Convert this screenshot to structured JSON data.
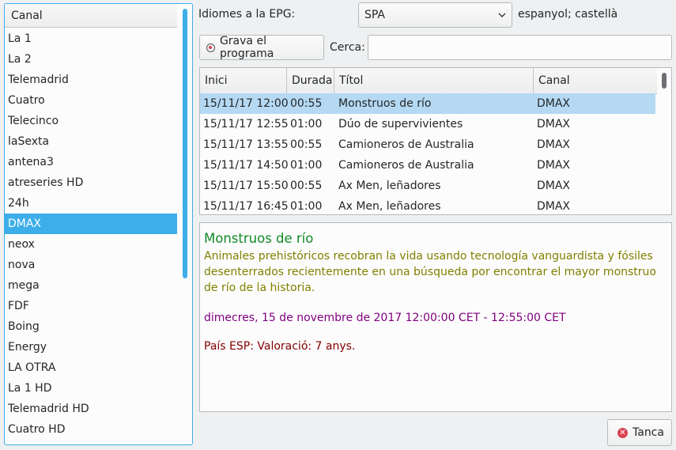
{
  "channels": {
    "header": "Canal",
    "items": [
      "La 1",
      "La 2",
      "Telemadrid",
      "Cuatro",
      "Telecinco",
      "laSexta",
      "antena3",
      "atreseries HD",
      "24h",
      "DMAX",
      "neox",
      "nova",
      "mega",
      "FDF",
      "Boing",
      "Energy",
      "LA OTRA",
      "La 1 HD",
      "Telemadrid HD",
      "Cuatro HD"
    ],
    "selected": "DMAX"
  },
  "epg_language": {
    "label": "Idiomes a la EPG:",
    "selected": "SPA",
    "description": "espanyol; castellà"
  },
  "record_button": {
    "label": "Grava el programa",
    "icon": "record-icon"
  },
  "search": {
    "label": "Cerca:",
    "value": ""
  },
  "program_table": {
    "columns": [
      "Inici",
      "Durada",
      "Títol",
      "Canal"
    ],
    "rows": [
      {
        "start": "15/11/17 12:00",
        "duration": "00:55",
        "title": "Monstruos de río",
        "channel": "DMAX"
      },
      {
        "start": "15/11/17 12:55",
        "duration": "01:00",
        "title": "Dúo de supervivientes",
        "channel": "DMAX"
      },
      {
        "start": "15/11/17 13:55",
        "duration": "00:55",
        "title": "Camioneros de Australia",
        "channel": "DMAX"
      },
      {
        "start": "15/11/17 14:50",
        "duration": "01:00",
        "title": "Camioneros de Australia",
        "channel": "DMAX"
      },
      {
        "start": "15/11/17 15:50",
        "duration": "00:55",
        "title": "Ax Men, leñadores",
        "channel": "DMAX"
      },
      {
        "start": "15/11/17 16:45",
        "duration": "01:00",
        "title": "Ax Men, leñadores",
        "channel": "DMAX"
      }
    ],
    "selected_row": 0
  },
  "details": {
    "title": "Monstruos de río",
    "description": "Animales prehistóricos recobran la vida usando tecnología vanguardista y fósiles desenterrados recientemente en una búsqueda por encontrar el mayor monstruo de río de la historia.",
    "date": "dimecres, 15 de novembre de 2017 12:00:00 CET - 12:55:00 CET",
    "rating": "País ESP: Valoració: 7 anys."
  },
  "close_button": {
    "label": "Tanca",
    "icon": "close-icon"
  },
  "colors": {
    "accent": "#3daee9",
    "title_green": "#118a26",
    "description_olive": "#808000",
    "date_purple": "#800080",
    "rating_maroon": "#800000"
  }
}
